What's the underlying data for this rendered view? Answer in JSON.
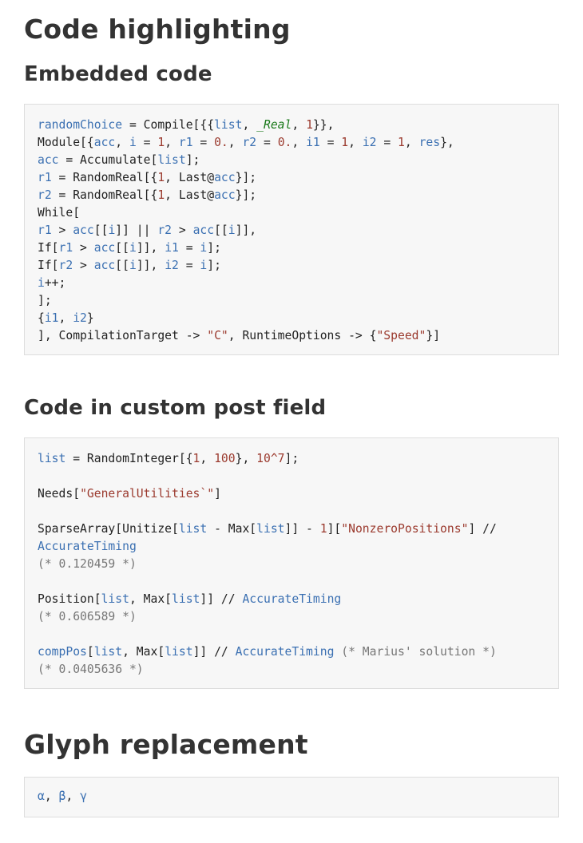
{
  "sections": {
    "title": "Code highlighting",
    "embedded_heading": "Embedded code",
    "custom_heading": "Code in custom post field",
    "glyph_heading": "Glyph replacement"
  },
  "embedded_code": [
    [
      [
        "s",
        "randomChoice"
      ],
      [
        "p",
        " = Compile[{{"
      ],
      [
        "s",
        "list"
      ],
      [
        "p",
        ", "
      ],
      [
        "g",
        "_Real"
      ],
      [
        "p",
        ", "
      ],
      [
        "n",
        "1"
      ],
      [
        "p",
        "}},"
      ]
    ],
    [
      [
        "p",
        "Module[{"
      ],
      [
        "s",
        "acc"
      ],
      [
        "p",
        ", "
      ],
      [
        "s",
        "i"
      ],
      [
        "p",
        " = "
      ],
      [
        "n",
        "1"
      ],
      [
        "p",
        ", "
      ],
      [
        "s",
        "r1"
      ],
      [
        "p",
        " = "
      ],
      [
        "n",
        "0."
      ],
      [
        "p",
        ", "
      ],
      [
        "s",
        "r2"
      ],
      [
        "p",
        " = "
      ],
      [
        "n",
        "0."
      ],
      [
        "p",
        ", "
      ],
      [
        "s",
        "i1"
      ],
      [
        "p",
        " = "
      ],
      [
        "n",
        "1"
      ],
      [
        "p",
        ", "
      ],
      [
        "s",
        "i2"
      ],
      [
        "p",
        " = "
      ],
      [
        "n",
        "1"
      ],
      [
        "p",
        ", "
      ],
      [
        "s",
        "res"
      ],
      [
        "p",
        "},"
      ]
    ],
    [
      [
        "s",
        "acc"
      ],
      [
        "p",
        " = Accumulate["
      ],
      [
        "s",
        "list"
      ],
      [
        "p",
        "];"
      ]
    ],
    [
      [
        "s",
        "r1"
      ],
      [
        "p",
        " = RandomReal[{"
      ],
      [
        "n",
        "1"
      ],
      [
        "p",
        ", Last@"
      ],
      [
        "s",
        "acc"
      ],
      [
        "p",
        "}];"
      ]
    ],
    [
      [
        "s",
        "r2"
      ],
      [
        "p",
        " = RandomReal[{"
      ],
      [
        "n",
        "1"
      ],
      [
        "p",
        ", Last@"
      ],
      [
        "s",
        "acc"
      ],
      [
        "p",
        "}];"
      ]
    ],
    [
      [
        "p",
        "While["
      ]
    ],
    [
      [
        "s",
        "r1"
      ],
      [
        "p",
        " > "
      ],
      [
        "s",
        "acc"
      ],
      [
        "p",
        "[["
      ],
      [
        "s",
        "i"
      ],
      [
        "p",
        "]] || "
      ],
      [
        "s",
        "r2"
      ],
      [
        "p",
        " > "
      ],
      [
        "s",
        "acc"
      ],
      [
        "p",
        "[["
      ],
      [
        "s",
        "i"
      ],
      [
        "p",
        "]],"
      ]
    ],
    [
      [
        "p",
        "If["
      ],
      [
        "s",
        "r1"
      ],
      [
        "p",
        " > "
      ],
      [
        "s",
        "acc"
      ],
      [
        "p",
        "[["
      ],
      [
        "s",
        "i"
      ],
      [
        "p",
        "]], "
      ],
      [
        "s",
        "i1"
      ],
      [
        "p",
        " = "
      ],
      [
        "s",
        "i"
      ],
      [
        "p",
        "];"
      ]
    ],
    [
      [
        "p",
        "If["
      ],
      [
        "s",
        "r2"
      ],
      [
        "p",
        " > "
      ],
      [
        "s",
        "acc"
      ],
      [
        "p",
        "[["
      ],
      [
        "s",
        "i"
      ],
      [
        "p",
        "]], "
      ],
      [
        "s",
        "i2"
      ],
      [
        "p",
        " = "
      ],
      [
        "s",
        "i"
      ],
      [
        "p",
        "];"
      ]
    ],
    [
      [
        "s",
        "i"
      ],
      [
        "p",
        "++;"
      ]
    ],
    [
      [
        "p",
        "];"
      ]
    ],
    [
      [
        "p",
        "{"
      ],
      [
        "s",
        "i1"
      ],
      [
        "p",
        ", "
      ],
      [
        "s",
        "i2"
      ],
      [
        "p",
        "}"
      ]
    ],
    [
      [
        "p",
        "], CompilationTarget -> "
      ],
      [
        "q",
        "\"C\""
      ],
      [
        "p",
        ", RuntimeOptions -> {"
      ],
      [
        "q",
        "\"Speed\""
      ],
      [
        "p",
        "}]"
      ]
    ]
  ],
  "custom_code": [
    [
      [
        "s",
        "list"
      ],
      [
        "p",
        " = RandomInteger[{"
      ],
      [
        "n",
        "1"
      ],
      [
        "p",
        ", "
      ],
      [
        "n",
        "100"
      ],
      [
        "p",
        "}, "
      ],
      [
        "n",
        "10^7"
      ],
      [
        "p",
        "];"
      ]
    ],
    [
      [
        "p",
        ""
      ]
    ],
    [
      [
        "p",
        "Needs["
      ],
      [
        "q",
        "\"GeneralUtilities`\""
      ],
      [
        "p",
        "]"
      ]
    ],
    [
      [
        "p",
        ""
      ]
    ],
    [
      [
        "p",
        "SparseArray[Unitize["
      ],
      [
        "s",
        "list"
      ],
      [
        "p",
        " - Max["
      ],
      [
        "s",
        "list"
      ],
      [
        "p",
        "]] - "
      ],
      [
        "n",
        "1"
      ],
      [
        "p",
        "]["
      ],
      [
        "q",
        "\"NonzeroPositions\""
      ],
      [
        "p",
        "] //"
      ]
    ],
    [
      [
        "s",
        "AccurateTiming"
      ]
    ],
    [
      [
        "c",
        "(* 0.120459 *)"
      ]
    ],
    [
      [
        "p",
        ""
      ]
    ],
    [
      [
        "p",
        "Position["
      ],
      [
        "s",
        "list"
      ],
      [
        "p",
        ", Max["
      ],
      [
        "s",
        "list"
      ],
      [
        "p",
        "]] // "
      ],
      [
        "s",
        "AccurateTiming"
      ]
    ],
    [
      [
        "c",
        "(* 0.606589 *)"
      ]
    ],
    [
      [
        "p",
        ""
      ]
    ],
    [
      [
        "s",
        "compPos"
      ],
      [
        "p",
        "["
      ],
      [
        "s",
        "list"
      ],
      [
        "p",
        ", Max["
      ],
      [
        "s",
        "list"
      ],
      [
        "p",
        "]] // "
      ],
      [
        "s",
        "AccurateTiming"
      ],
      [
        "p",
        " "
      ],
      [
        "c",
        "(* Marius' solution *)"
      ]
    ],
    [
      [
        "c",
        "(* 0.0405636 *)"
      ]
    ]
  ],
  "glyph_code": [
    [
      [
        "s",
        "α"
      ],
      [
        "p",
        ", "
      ],
      [
        "s",
        "β"
      ],
      [
        "p",
        ", "
      ],
      [
        "s",
        "γ"
      ]
    ]
  ]
}
